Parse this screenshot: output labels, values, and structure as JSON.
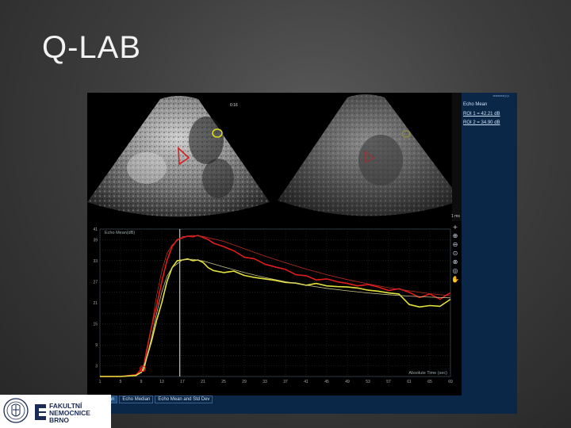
{
  "slide": {
    "title": "Q-LAB"
  },
  "ultrasound": {
    "timestamp": "0:16",
    "roi_colors": {
      "roi1": "#d62020",
      "roi2": "#d8d820"
    }
  },
  "side_panel": {
    "header": "=====>>",
    "title": "Echo Mean",
    "roi1": "ROI 1 = 42.21 dB",
    "roi2": "ROI 2 = 34.90 dB",
    "time": "1 ms"
  },
  "tabs": [
    "Echo Mean",
    "Echo Median",
    "Echo Mean and Std Dev"
  ],
  "logo": {
    "name": "FAKULTNÍ NEMOCNICE BRNO"
  },
  "chart_data": {
    "type": "line",
    "title": "",
    "ylabel": "Echo Mean(dB)",
    "xlabel": "Absolute Time (sec)",
    "xlim": [
      1,
      69
    ],
    "ylim": [
      0,
      42
    ],
    "x_ticks": [
      1,
      5,
      9,
      13,
      17,
      21,
      25,
      29,
      33,
      37,
      41,
      45,
      49,
      53,
      57,
      61,
      65,
      69
    ],
    "y_ticks": [
      0,
      3,
      6,
      9,
      12,
      15,
      18,
      21,
      24,
      27,
      30,
      33,
      36,
      39,
      42
    ],
    "y_tick_labels": [
      "",
      "3",
      "",
      "9",
      "",
      "15",
      "",
      "21",
      "",
      "27",
      "",
      "33",
      "",
      "39",
      "41"
    ],
    "marker_x": 16.5,
    "series": [
      {
        "color": "#e21c1c",
        "x": [
          1,
          5,
          8,
          9,
          9.5,
          10,
          11,
          12,
          13,
          14,
          15,
          16,
          17,
          18,
          19,
          20,
          21,
          22,
          23,
          25,
          27,
          29,
          31,
          33,
          35,
          37,
          39,
          41,
          43,
          45,
          47,
          49,
          51,
          53,
          55,
          57,
          59,
          61,
          63,
          65,
          67,
          68,
          69
        ],
        "y": [
          0,
          0,
          0.5,
          2,
          3,
          7,
          14,
          20,
          27,
          33,
          37,
          39,
          39.5,
          40,
          39.8,
          40.2,
          39.6,
          39,
          38,
          37,
          35.8,
          34,
          33.5,
          32,
          31.2,
          30.5,
          29,
          28.7,
          27.5,
          27.8,
          27,
          26.5,
          25.8,
          26.2,
          25.5,
          24.5,
          25,
          24,
          22.5,
          23.5,
          22,
          23,
          23.8
        ]
      },
      {
        "color": "#b8301c",
        "x": [
          9,
          10,
          11,
          12,
          13,
          14,
          15,
          17,
          19,
          21,
          25,
          29,
          33,
          37,
          41,
          45,
          49,
          53,
          57,
          61,
          65,
          69
        ],
        "y": [
          1,
          6,
          14,
          23,
          30,
          35,
          37.5,
          39.8,
          40.2,
          39.9,
          38.5,
          36.4,
          34.3,
          32.4,
          30.6,
          29,
          27.6,
          26.4,
          25.3,
          24.4,
          23.6,
          23
        ]
      },
      {
        "color": "#e4e23a",
        "x": [
          1,
          5,
          8,
          9,
          9.5,
          10,
          11,
          12,
          13,
          14,
          15,
          16,
          17,
          18,
          19,
          20,
          21,
          22,
          23,
          25,
          27,
          29,
          31,
          33,
          35,
          37,
          39,
          41,
          43,
          45,
          47,
          49,
          51,
          53,
          55,
          57,
          59,
          61,
          63,
          65,
          67,
          68,
          69
        ],
        "y": [
          0,
          0,
          0.3,
          1.2,
          2,
          5,
          10,
          16,
          21,
          27,
          31,
          33,
          33.2,
          33.5,
          33,
          33.2,
          32.5,
          31,
          30.2,
          29.6,
          30,
          28.8,
          28.2,
          27.8,
          27.4,
          26.8,
          26.6,
          26,
          26.5,
          25.8,
          25.6,
          25.5,
          25.2,
          24.6,
          24.3,
          23.8,
          23.5,
          20.5,
          19.8,
          20.2,
          20,
          21,
          22
        ]
      },
      {
        "color": "#c9c486",
        "x": [
          9,
          10,
          11,
          12,
          13,
          14,
          15,
          17,
          19,
          21,
          25,
          29,
          33,
          37,
          41,
          45,
          49,
          53,
          57,
          61,
          65,
          69
        ],
        "y": [
          1,
          5,
          11,
          18,
          24,
          28.5,
          31,
          33.2,
          33.4,
          32.9,
          31.2,
          29.6,
          28.2,
          27,
          26,
          25.1,
          24.4,
          23.8,
          23.3,
          22.9,
          22.6,
          22.4
        ]
      }
    ]
  }
}
